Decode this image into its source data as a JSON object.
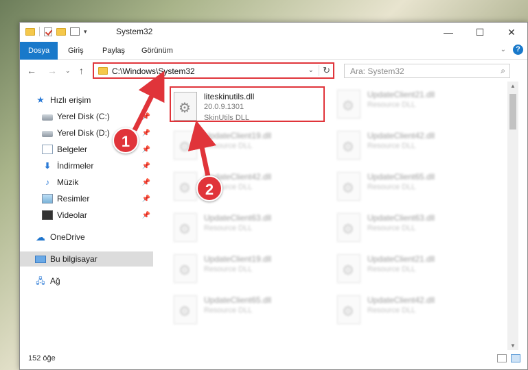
{
  "window": {
    "title": "System32"
  },
  "ribbon": {
    "tabs": [
      "Dosya",
      "Giriş",
      "Paylaş",
      "Görünüm"
    ]
  },
  "address": {
    "path": "C:\\Windows\\System32"
  },
  "search": {
    "placeholder": "Ara: System32"
  },
  "sidebar": {
    "items": [
      {
        "label": "Hızlı erişim",
        "icon": "star-icon"
      },
      {
        "label": "Yerel Disk (C:)",
        "icon": "disk-icon",
        "pinned": true
      },
      {
        "label": "Yerel Disk (D:)",
        "icon": "disk-icon",
        "pinned": true
      },
      {
        "label": "Belgeler",
        "icon": "documents-icon",
        "pinned": true
      },
      {
        "label": "İndirmeler",
        "icon": "download-icon",
        "pinned": true
      },
      {
        "label": "Müzik",
        "icon": "music-icon",
        "pinned": true
      },
      {
        "label": "Resimler",
        "icon": "pictures-icon",
        "pinned": true
      },
      {
        "label": "Videolar",
        "icon": "videos-icon",
        "pinned": true
      },
      {
        "label": "OneDrive",
        "icon": "cloud-icon"
      },
      {
        "label": "Bu bilgisayar",
        "icon": "computer-icon",
        "selected": true
      },
      {
        "label": "Ağ",
        "icon": "network-icon"
      }
    ]
  },
  "files": [
    {
      "name": "liteskinutils.dll",
      "line2": "20.0.9.1301",
      "line3": "SkinUtils DLL",
      "highlight": true
    },
    {
      "name": "UpdateClient21.dll",
      "line2": "Resource DLL"
    },
    {
      "name": "UpdateClient19.dll",
      "line2": "Resource DLL"
    },
    {
      "name": "UpdateClient42.dll",
      "line2": "Resource DLL"
    },
    {
      "name": "UpdateClient42.dll",
      "line2": "Resource DLL"
    },
    {
      "name": "UpdateClient65.dll",
      "line2": "Resource DLL"
    },
    {
      "name": "UpdateClient63.dll",
      "line2": "Resource DLL"
    },
    {
      "name": "UpdateClient63.dll",
      "line2": "Resource DLL"
    },
    {
      "name": "UpdateClient19.dll",
      "line2": "Resource DLL"
    },
    {
      "name": "UpdateClient21.dll",
      "line2": "Resource DLL"
    },
    {
      "name": "UpdateClient65.dll",
      "line2": "Resource DLL"
    },
    {
      "name": "UpdateClient42.dll",
      "line2": "Resource DLL"
    }
  ],
  "status": {
    "item_count": "152 öğe"
  },
  "annotations": {
    "step1": "1",
    "step2": "2",
    "color": "#e0343a"
  }
}
